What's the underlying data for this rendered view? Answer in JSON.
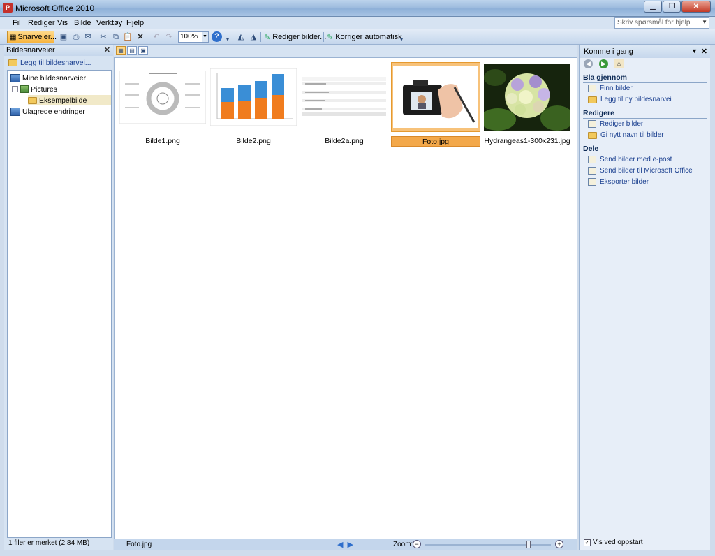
{
  "window": {
    "title": "Microsoft Office 2010"
  },
  "menu": {
    "items": [
      {
        "label": "Fil"
      },
      {
        "label": "Rediger"
      },
      {
        "label": "Vis"
      },
      {
        "label": "Bilde"
      },
      {
        "label": "Verktøy"
      },
      {
        "label": "Hjelp"
      }
    ],
    "help_placeholder": "Skriv spørsmål for hjelp"
  },
  "toolbar": {
    "shortcuts_label": "Snarveier...",
    "zoom_value": "100%",
    "edit_pictures_label": "Rediger bilder...",
    "auto_correct_label": "Korriger automatisk"
  },
  "left_pane": {
    "title": "Bildesnarveier",
    "add_shortcut": "Legg til bildesnarvei...",
    "tree": {
      "root": "Mine bildesnarveier",
      "pictures": "Pictures",
      "example": "Eksempelbilde",
      "unsaved": "Ulagrede endringer"
    },
    "status": "1 filer er merket (2,84 MB)"
  },
  "thumbnails": [
    {
      "caption": "Bilde1.png"
    },
    {
      "caption": "Bilde2.png"
    },
    {
      "caption": "Bilde2a.png"
    },
    {
      "caption": "Foto.jpg"
    },
    {
      "caption": "Hydrangeas1-300x231.jpg"
    }
  ],
  "main_status": {
    "filename": "Foto.jpg",
    "zoom_label": "Zoom:"
  },
  "right_pane": {
    "title": "Komme i gang",
    "sections": {
      "browse": {
        "title": "Bla gjennom",
        "links": [
          "Finn bilder",
          "Legg til ny bildesnarvei"
        ]
      },
      "edit": {
        "title": "Redigere",
        "links": [
          "Rediger bilder",
          "Gi nytt navn til bilder"
        ]
      },
      "share": {
        "title": "Dele",
        "links": [
          "Send bilder med e-post",
          "Send bilder til Microsoft Office",
          "Eksporter bilder"
        ]
      }
    },
    "startup_label": "Vis ved oppstart"
  },
  "colors": {
    "selection": "#f3a84a",
    "link": "#1a3f8f",
    "pane_bg": "#d6e3f2"
  }
}
